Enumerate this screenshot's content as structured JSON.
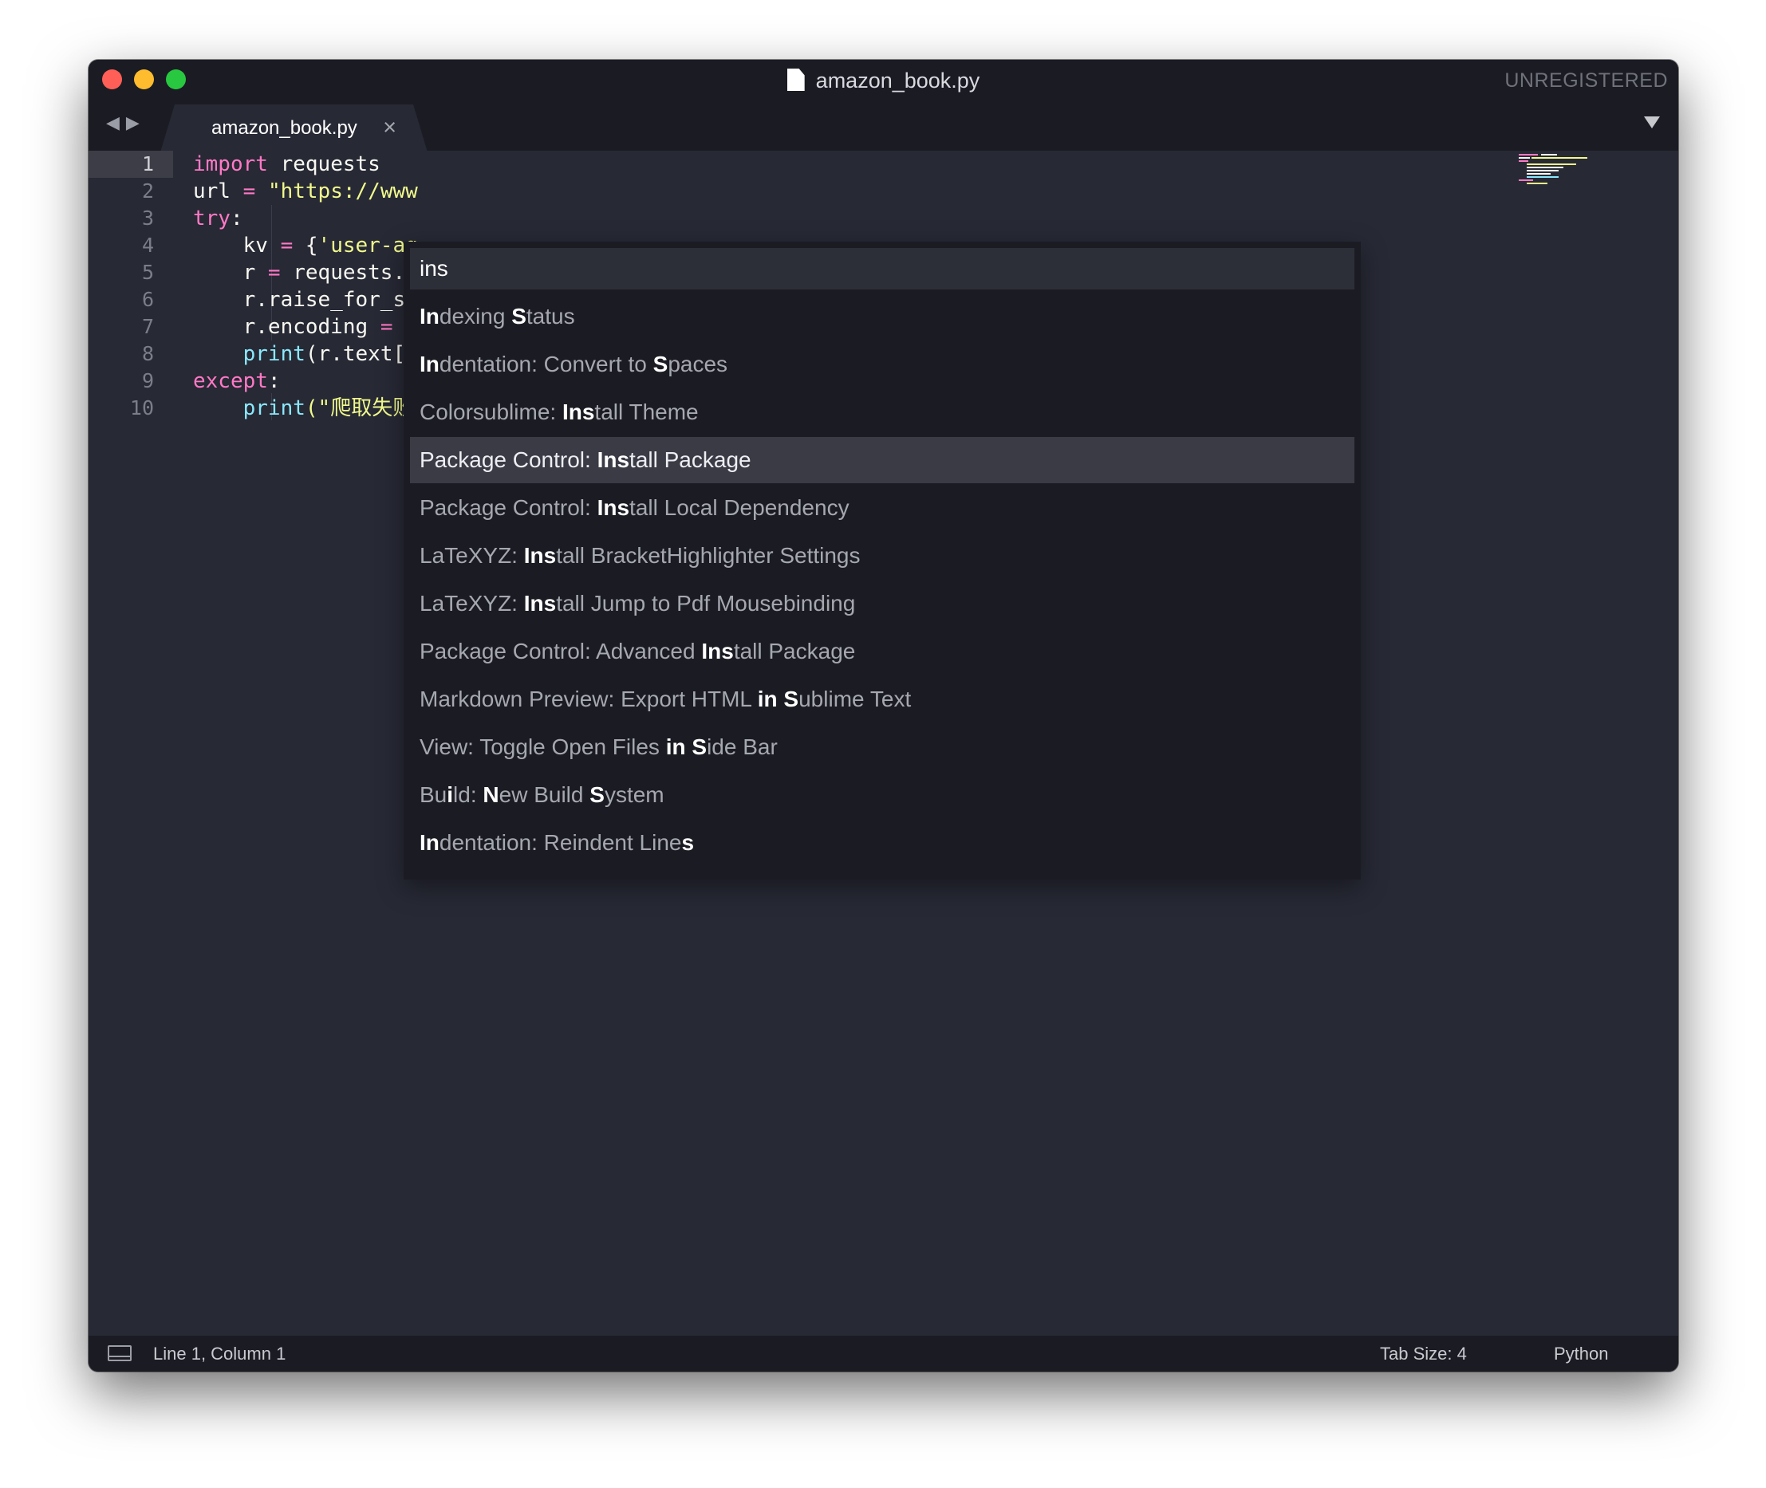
{
  "window": {
    "title": "amazon_book.py",
    "registration": "UNREGISTERED"
  },
  "tabs": [
    {
      "label": "amazon_book.py",
      "close_glyph": "×",
      "active": true
    }
  ],
  "nav": {
    "back_glyph": "◀",
    "forward_glyph": "▶"
  },
  "editor": {
    "line_numbers": [
      "1",
      "2",
      "3",
      "4",
      "5",
      "6",
      "7",
      "8",
      "9",
      "10"
    ],
    "code_lines": [
      [
        {
          "t": "import",
          "c": "kw"
        },
        {
          "t": " requests"
        }
      ],
      [
        {
          "t": "url "
        },
        {
          "t": "=",
          "c": "op"
        },
        {
          "t": " "
        },
        {
          "t": "\"https://www",
          "c": "str"
        }
      ],
      [
        {
          "t": "try",
          "c": "kw"
        },
        {
          "t": ":"
        }
      ],
      [
        {
          "t": "    kv "
        },
        {
          "t": "=",
          "c": "op"
        },
        {
          "t": " {"
        },
        {
          "t": "'user-ag",
          "c": "str"
        }
      ],
      [
        {
          "t": "    r "
        },
        {
          "t": "=",
          "c": "op"
        },
        {
          "t": " requests."
        }
      ],
      [
        {
          "t": "    r.raise_for_st"
        }
      ],
      [
        {
          "t": "    r.encoding "
        },
        {
          "t": "=",
          "c": "op"
        }
      ],
      [
        {
          "t": "    "
        },
        {
          "t": "print",
          "c": "fn"
        },
        {
          "t": "(r.text["
        }
      ],
      [
        {
          "t": "except",
          "c": "kw"
        },
        {
          "t": ":"
        }
      ],
      [
        {
          "t": "    "
        },
        {
          "t": "print",
          "c": "fn"
        },
        {
          "t": "(\"爬取失败",
          "c": "str"
        }
      ]
    ]
  },
  "command_palette": {
    "query": "ins",
    "selected_index": 3,
    "items": [
      [
        {
          "t": "In",
          "b": true
        },
        {
          "t": "dexing "
        },
        {
          "t": "S",
          "b": true
        },
        {
          "t": "tatus"
        }
      ],
      [
        {
          "t": "In",
          "b": true
        },
        {
          "t": "dentation: Convert to "
        },
        {
          "t": "S",
          "b": true
        },
        {
          "t": "paces"
        }
      ],
      [
        {
          "t": "Colorsublime: "
        },
        {
          "t": "Ins",
          "b": true
        },
        {
          "t": "tall Theme"
        }
      ],
      [
        {
          "t": "Package Control: "
        },
        {
          "t": "Ins",
          "b": true
        },
        {
          "t": "tall Package"
        }
      ],
      [
        {
          "t": "Package Control: "
        },
        {
          "t": "Ins",
          "b": true
        },
        {
          "t": "tall Local Dependency"
        }
      ],
      [
        {
          "t": "LaTeXYZ: "
        },
        {
          "t": "Ins",
          "b": true
        },
        {
          "t": "tall BracketHighlighter Settings"
        }
      ],
      [
        {
          "t": "LaTeXYZ: "
        },
        {
          "t": "Ins",
          "b": true
        },
        {
          "t": "tall Jump to Pdf Mousebinding"
        }
      ],
      [
        {
          "t": "Package Control: Advanced "
        },
        {
          "t": "Ins",
          "b": true
        },
        {
          "t": "tall Package"
        }
      ],
      [
        {
          "t": "Markdown Preview: Export HTML "
        },
        {
          "t": "in",
          "b": true
        },
        {
          "t": " "
        },
        {
          "t": "S",
          "b": true
        },
        {
          "t": "ublime Text"
        }
      ],
      [
        {
          "t": "View: Toggle Open Files "
        },
        {
          "t": "in",
          "b": true
        },
        {
          "t": " "
        },
        {
          "t": "S",
          "b": true
        },
        {
          "t": "ide Bar"
        }
      ],
      [
        {
          "t": "Bu"
        },
        {
          "t": "i",
          "b": true
        },
        {
          "t": "ld: "
        },
        {
          "t": "N",
          "b": true
        },
        {
          "t": "ew Build "
        },
        {
          "t": "S",
          "b": true
        },
        {
          "t": "ystem"
        }
      ],
      [
        {
          "t": "In",
          "b": true
        },
        {
          "t": "dentation: Reindent Line"
        },
        {
          "t": "s",
          "b": true
        }
      ]
    ]
  },
  "statusbar": {
    "position": "Line 1, Column 1",
    "tab_size": "Tab Size: 4",
    "syntax": "Python"
  },
  "colors": {
    "editor_bg": "#272935",
    "chrome_bg": "#1b1c23",
    "keyword": "#ff79c6",
    "string": "#f1fa8c",
    "function": "#8be9fd",
    "close_red": "#ff5f57",
    "minimize_yellow": "#febc2e",
    "zoom_green": "#28c840"
  }
}
